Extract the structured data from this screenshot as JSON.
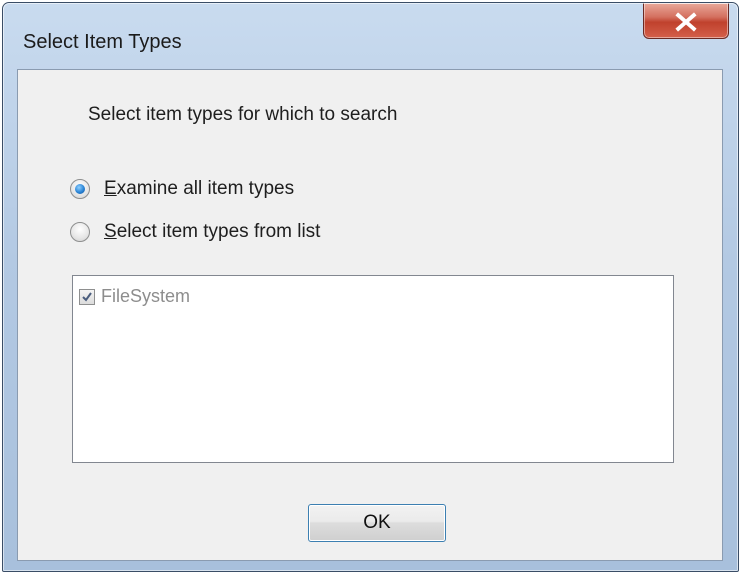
{
  "window": {
    "title": "Select Item Types"
  },
  "dialog": {
    "prompt": "Select item types for which to search",
    "options": [
      {
        "label": "Examine all item types",
        "accel": "E",
        "rest": "xamine all item types",
        "checked": true
      },
      {
        "label": "Select item types from list",
        "accel": "S",
        "rest": "elect item types from list",
        "checked": false
      }
    ],
    "item_types": [
      {
        "label": "FileSystem",
        "checked": true
      }
    ],
    "ok_label": "OK"
  },
  "icons": {
    "close": "close-icon",
    "check": "check-icon"
  },
  "colors": {
    "title_bar": "#b3c9e3",
    "close_button": "#c0412d",
    "client_bg": "#f0f0f0",
    "radio_dot": "#2a84d6",
    "disabled_text": "#8d8d8d",
    "button_border": "#3c7fb1"
  }
}
